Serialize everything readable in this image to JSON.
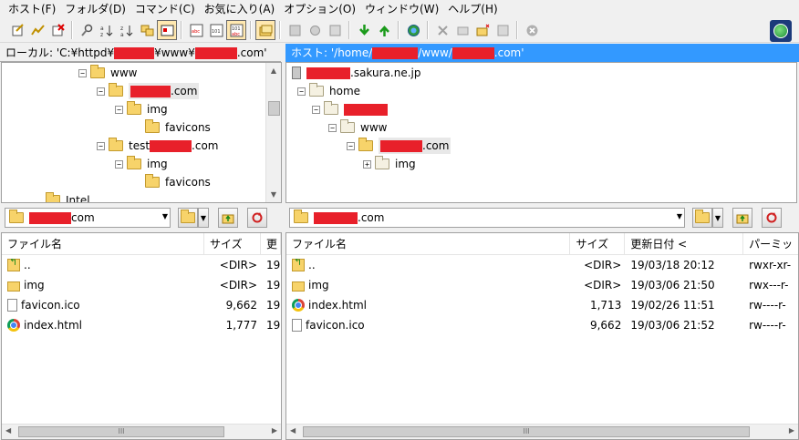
{
  "menu": [
    "ホスト(F)",
    "フォルダ(D)",
    "コマンド(C)",
    "お気に入り(A)",
    "オプション(O)",
    "ウィンドウ(W)",
    "ヘルプ(H)"
  ],
  "toolbar": {
    "icons": [
      "connect-icon",
      "quick-connect-icon",
      "disconnect-icon",
      "search-icon",
      "sort-name-icon",
      "sort-ext-icon",
      "sync-icon",
      "view-icon",
      "binary-icon",
      "ascii-icon",
      "auto-icon",
      "folder-view-icon",
      "upload-queue-icon",
      "download-icon",
      "upload-icon",
      "internet-icon",
      "delete-icon",
      "rename-icon",
      "mkdir-icon",
      "chmod-icon",
      "stop-icon"
    ]
  },
  "local": {
    "path_prefix": "ローカル: 'C:¥httpd¥",
    "path_mid": "¥www¥",
    "path_suffix": ".com'",
    "tree": [
      {
        "label": "www",
        "indent": 0,
        "exp": "⊟"
      },
      {
        "label": ".com",
        "indent": 1,
        "exp": "⊟",
        "redacted": true,
        "selected": true
      },
      {
        "label": "img",
        "indent": 2,
        "exp": "⊟"
      },
      {
        "label": "favicons",
        "indent": 3,
        "exp": ""
      },
      {
        "label": ".com",
        "prefix": "test",
        "indent": 1,
        "exp": "⊟",
        "redacted": true
      },
      {
        "label": "img",
        "indent": 2,
        "exp": "⊟"
      },
      {
        "label": "favicons",
        "indent": 3,
        "exp": ""
      },
      {
        "label": "Intel",
        "indent": -1,
        "exp": "⊞"
      }
    ],
    "combo_suffix": "com",
    "columns": [
      "ファイル名",
      "サイズ",
      "更"
    ],
    "files": [
      {
        "name": "..",
        "size": "<DIR>",
        "date": "19",
        "icon": "up"
      },
      {
        "name": "img",
        "size": "<DIR>",
        "date": "19",
        "icon": "folder"
      },
      {
        "name": "favicon.ico",
        "size": "9,662",
        "date": "19",
        "icon": "doc"
      },
      {
        "name": "index.html",
        "size": "1,777",
        "date": "19",
        "icon": "chrome"
      }
    ]
  },
  "remote": {
    "path_prefix": "ホスト: '/home/",
    "path_mid": "/www/",
    "path_suffix": ".com'",
    "host_suffix": ".sakura.ne.jp",
    "tree": [
      {
        "label": "home",
        "indent": 1,
        "exp": "⊟"
      },
      {
        "label": "",
        "indent": 2,
        "exp": "⊟",
        "redacted": true
      },
      {
        "label": "www",
        "indent": 3,
        "exp": "⊟"
      },
      {
        "label": ".com",
        "indent": 4,
        "exp": "⊟",
        "redacted": true,
        "selected": true
      },
      {
        "label": "img",
        "indent": 5,
        "exp": "⊞"
      }
    ],
    "combo_suffix": ".com",
    "columns": [
      "ファイル名",
      "サイズ",
      "更新日付 <",
      "パーミッ"
    ],
    "files": [
      {
        "name": "..",
        "size": "<DIR>",
        "date": "19/03/18 20:12",
        "perm": "rwxr-xr-",
        "icon": "up"
      },
      {
        "name": "img",
        "size": "<DIR>",
        "date": "19/03/06 21:50",
        "perm": "rwx---r-",
        "icon": "folder"
      },
      {
        "name": "index.html",
        "size": "1,713",
        "date": "19/02/26 11:51",
        "perm": "rw----r-",
        "icon": "chrome"
      },
      {
        "name": "favicon.ico",
        "size": "9,662",
        "date": "19/03/06 21:52",
        "perm": "rw----r-",
        "icon": "doc"
      }
    ]
  },
  "scroll_grip": "III"
}
